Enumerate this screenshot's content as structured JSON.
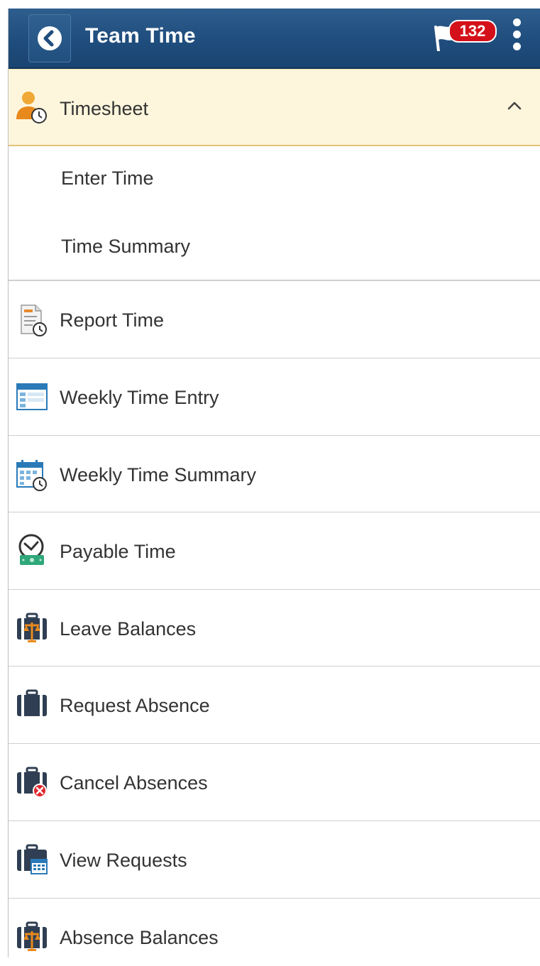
{
  "header": {
    "title": "Team Time",
    "notification_count": "132"
  },
  "menu": {
    "timesheet": {
      "label": "Timesheet",
      "icon": "person-clock-icon",
      "expanded": true
    },
    "sub_items": [
      {
        "label": "Enter Time"
      },
      {
        "label": "Time Summary"
      }
    ],
    "items": [
      {
        "label": "Report Time",
        "icon": "document-clock-icon"
      },
      {
        "label": "Weekly Time Entry",
        "icon": "window-form-icon"
      },
      {
        "label": "Weekly Time Summary",
        "icon": "calendar-clock-icon"
      },
      {
        "label": "Payable Time",
        "icon": "clock-money-icon"
      },
      {
        "label": "Leave Balances",
        "icon": "briefcase-scales-icon"
      },
      {
        "label": "Request Absence",
        "icon": "briefcase-icon"
      },
      {
        "label": "Cancel Absences",
        "icon": "briefcase-cancel-icon"
      },
      {
        "label": "View Requests",
        "icon": "briefcase-calendar-icon"
      },
      {
        "label": "Absence Balances",
        "icon": "briefcase-scales-icon"
      }
    ]
  },
  "colors": {
    "header_bg": "#1f4d7d",
    "badge": "#d4111a",
    "selected_row_bg": "#fdf6dc",
    "text": "#333333"
  }
}
